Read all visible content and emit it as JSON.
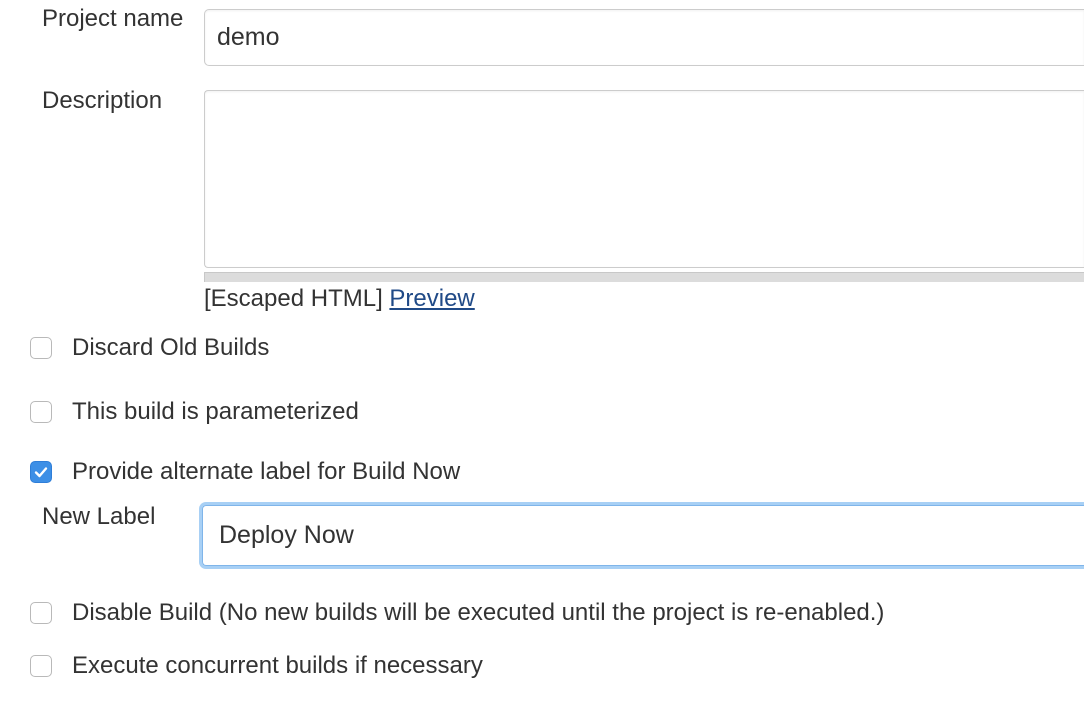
{
  "form": {
    "project_name": {
      "label": "Project name",
      "value": "demo"
    },
    "description": {
      "label": "Description",
      "value": "",
      "format_note": "[Escaped HTML]",
      "preview_link": "Preview"
    },
    "options": [
      {
        "label": "Discard Old Builds",
        "checked": false
      },
      {
        "label": "This build is parameterized",
        "checked": false
      },
      {
        "label": "Provide alternate label for Build Now",
        "checked": true
      },
      {
        "label": "Disable Build (No new builds will be executed until the project is re-enabled.)",
        "checked": false
      },
      {
        "label": "Execute concurrent builds if necessary",
        "checked": false
      }
    ],
    "new_label": {
      "label": "New Label",
      "value": "Deploy Now"
    }
  },
  "colors": {
    "checkbox_checked": "#3d8fe6",
    "link": "#204a87",
    "focus_ring": "#a8d0f5"
  },
  "icons": {
    "checkmark": "check-icon"
  }
}
